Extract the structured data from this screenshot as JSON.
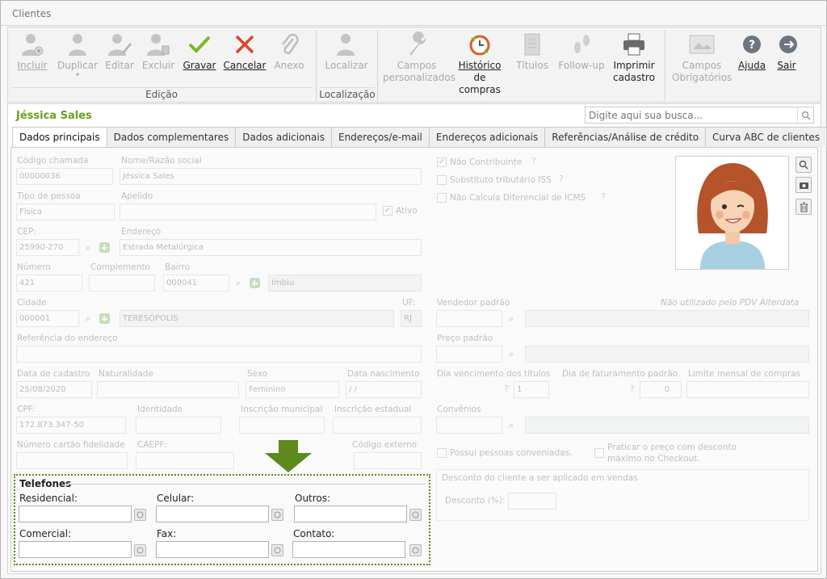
{
  "window": {
    "title": "Clientes"
  },
  "ribbon": {
    "groups": {
      "edicao": "Edição",
      "localizacao": "Localização"
    },
    "buttons": {
      "incluir": "Incluir",
      "duplicar": "Duplicar",
      "editar": "Editar",
      "excluir": "Excluir",
      "gravar": "Gravar",
      "cancelar": "Cancelar",
      "anexo": "Anexo",
      "localizar": "Localizar",
      "campos_personalizados_1": "Campos",
      "campos_personalizados_2": "personalizados",
      "historico_1": "Histórico",
      "historico_2": "de compras",
      "titulos": "Títulos",
      "followup": "Follow-up",
      "imprimir_1": "Imprimir",
      "imprimir_2": "cadastro",
      "campos_obrig_1": "Campos",
      "campos_obrig_2": "Obrigatórios",
      "ajuda": "Ajuda",
      "sair": "Sair"
    }
  },
  "customer": {
    "name": "Jéssica Sales"
  },
  "search": {
    "placeholder": "Digite aqui sua busca..."
  },
  "tabs": [
    {
      "label": "Dados principais"
    },
    {
      "label": "Dados complementares"
    },
    {
      "label": "Dados adicionais"
    },
    {
      "label": "Endereços/e-mail"
    },
    {
      "label": "Endereços adicionais"
    },
    {
      "label": "Referências/Análise de crédito"
    },
    {
      "label": "Curva ABC de clientes"
    }
  ],
  "form": {
    "labels": {
      "codigo": "Código chamada",
      "nome": "Nome/Razão social",
      "tipo": "Tipo de pessoa",
      "apelido": "Apelido",
      "ativo": "Ativo",
      "cep": "CEP:",
      "endereco": "Endereço",
      "numero": "Número",
      "complemento": "Complemento",
      "bairro": "Bairro",
      "cidade": "Cidade",
      "uf": "UF:",
      "referencia": "Referência do endereço",
      "data_cadastro": "Data de cadastro",
      "naturalidade": "Naturalidade",
      "sexo": "Sexo",
      "data_nasc": "Data nascimento",
      "cpf": "CPF:",
      "identidade": "Identidade",
      "insc_municipal": "Inscrição municipal",
      "insc_estadual": "Inscrição estadual",
      "cartao": "Número cartão fidelidade",
      "caepf": "CAEPF:",
      "codigo_externo": "Código externo",
      "nao_contribuinte": "Não Contribuinte",
      "substituto": "Substituto tributário ISS",
      "nao_calcula": "Não Calcula Diferencial de ICMS",
      "vendedor": "Vendedor padrão",
      "nao_utilizado": "Não utilizado pelo PDV Alterdata",
      "preco": "Preço padrão",
      "dia_venc": "Dia vencimento dos títulos",
      "dia_fat": "Dia de faturamento padrão",
      "limite": "Limite mensal de compras",
      "convenios": "Convênios",
      "possui_pessoas": "Possui pessoas conveniadas.",
      "praticar_1": "Praticar o preço com desconto",
      "praticar_2": "máximo no Checkout.",
      "desconto_group": "Desconto do cliente a ser aplicado em vendas",
      "desconto": "Desconto (%):"
    },
    "values": {
      "codigo": "00000036",
      "nome": "Jéssica Sales",
      "tipo": "Física",
      "cep": "25990-270",
      "endereco": "Estrada Metalúrgica",
      "numero": "421",
      "bairro_code": "000041",
      "bairro_name": "Imbiu",
      "cidade_code": "000001",
      "cidade_name": "TERESÓPOLIS",
      "uf": "RJ",
      "data_cadastro": "25/08/2020",
      "sexo": "Feminino",
      "data_nasc": "/ /",
      "cpf": "172.873.347-50",
      "dia_venc": "1",
      "dia_fat": "0"
    }
  },
  "telefones": {
    "title": "Telefones",
    "residencial": "Residencial:",
    "celular": "Celular:",
    "outros": "Outros:",
    "comercial": "Comercial:",
    "fax": "Fax:",
    "contato": "Contato:"
  },
  "colors": {
    "accent_green": "#6b9d1f",
    "arrow_green": "#5c8a1c",
    "dotted_border": "#5c8a1c"
  }
}
